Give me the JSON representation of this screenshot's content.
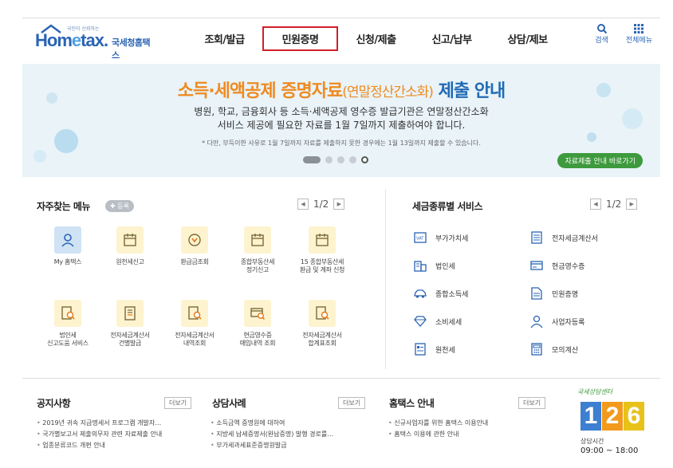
{
  "header": {
    "logo_tagline": "국민이 신뢰하는",
    "logo_home": "Hom",
    "logo_e": "e",
    "logo_tax": "tax.",
    "logo_name": "국세청홈택스",
    "nav": [
      "조회/발급",
      "민원증명",
      "신청/제출",
      "신고/납부",
      "상담/제보"
    ],
    "active_nav": "민원증명",
    "search_label": "검색",
    "allmenu_label": "전체메뉴"
  },
  "banner": {
    "title_main": "소득·세액공제 증명자료",
    "title_paren": "(연말정산간소화)",
    "title_tail": "제출 안내",
    "sub1": "병원, 학교, 금융회사 등 소득·세액공제 영수증 발급기관은 연말정산간소화",
    "sub2": "서비스 제공에 필요한 자료를 1월 7일까지 제출하여야 합니다.",
    "note": "* 다만, 부득이한 사유로 1월 7일까지 자료를 제출하지 못한 경우에는 1월 13일까지 제출할 수 있습니다.",
    "button": "자료제출 안내 바로가기",
    "colors": {
      "title": "#ef8a1f",
      "title_accent": "#1f6bb5",
      "button": "#3d9a3d"
    }
  },
  "frequent": {
    "title": "자주찾는 메뉴",
    "badge": "✚ 등록",
    "page": "1/2",
    "items": [
      {
        "label1": "My 홈택스",
        "label2": "",
        "icon": "person-icon"
      },
      {
        "label1": "원천세신고",
        "label2": "",
        "icon": "calendar-icon"
      },
      {
        "label1": "환급금조회",
        "label2": "",
        "icon": "refund-icon"
      },
      {
        "label1": "종합부동산세",
        "label2": "정기신고",
        "icon": "calendar-icon"
      },
      {
        "label1": "15 종합부동산세",
        "label2": "환급 및 계좌 신청",
        "icon": "calendar-icon"
      },
      {
        "label1": "법인세",
        "label2": "신고도움 서비스",
        "icon": "doc-search-icon"
      },
      {
        "label1": "전자세금계산서",
        "label2": "건별발급",
        "icon": "invoice-icon"
      },
      {
        "label1": "전자세금계산서",
        "label2": "내역조회",
        "icon": "doc-search-icon"
      },
      {
        "label1": "현금영수증",
        "label2": "매입내역 조회",
        "icon": "card-search-icon"
      },
      {
        "label1": "전자세금계산서",
        "label2": "합계표조회",
        "icon": "doc-search-icon"
      }
    ]
  },
  "taxservice": {
    "title": "세금종류별 서비스",
    "page": "1/2",
    "items": [
      {
        "label": "부가가치세",
        "icon": "vat-icon"
      },
      {
        "label": "전자세금계산서",
        "icon": "invoice-icon"
      },
      {
        "label": "법인세",
        "icon": "building-icon"
      },
      {
        "label": "현금영수증",
        "icon": "receipt-icon"
      },
      {
        "label": "종합소득세",
        "icon": "car-icon"
      },
      {
        "label": "민원증명",
        "icon": "document-icon"
      },
      {
        "label": "소비세세",
        "icon": "diamond-icon"
      },
      {
        "label": "사업자등록",
        "icon": "user-icon"
      },
      {
        "label": "원천세",
        "icon": "form-icon"
      },
      {
        "label": "모의계산",
        "icon": "calculator-icon"
      }
    ]
  },
  "notice": {
    "title": "공지사항",
    "more": "더보기",
    "items": [
      "2019년 귀속 지급명세서 프로그램 개발자…",
      "국가별보고서 제출의무자 관련 자료제출 안내",
      "업종분류코드 개편 안내"
    ]
  },
  "consult": {
    "title": "상담사례",
    "more": "더보기",
    "items": [
      "소득금액 증명원에 대하여",
      "지방세 납세증명서(완납증명) 발행 경로를…",
      "부가세과세표준증명원발급"
    ]
  },
  "guide": {
    "title": "홈택스 안내",
    "more": "더보기",
    "items": [
      "신규사업자를 위한 홈택스 이용안내",
      "홈택스 이용에 관한 안내"
    ]
  },
  "callcenter": {
    "top": "국세상담센터",
    "digits": [
      "1",
      "2",
      "6"
    ],
    "label": "상담시간",
    "hours": "09:00 ~ 18:00",
    "colors": [
      "#3d7fd0",
      "#f29a1c",
      "#e8c21a"
    ]
  }
}
